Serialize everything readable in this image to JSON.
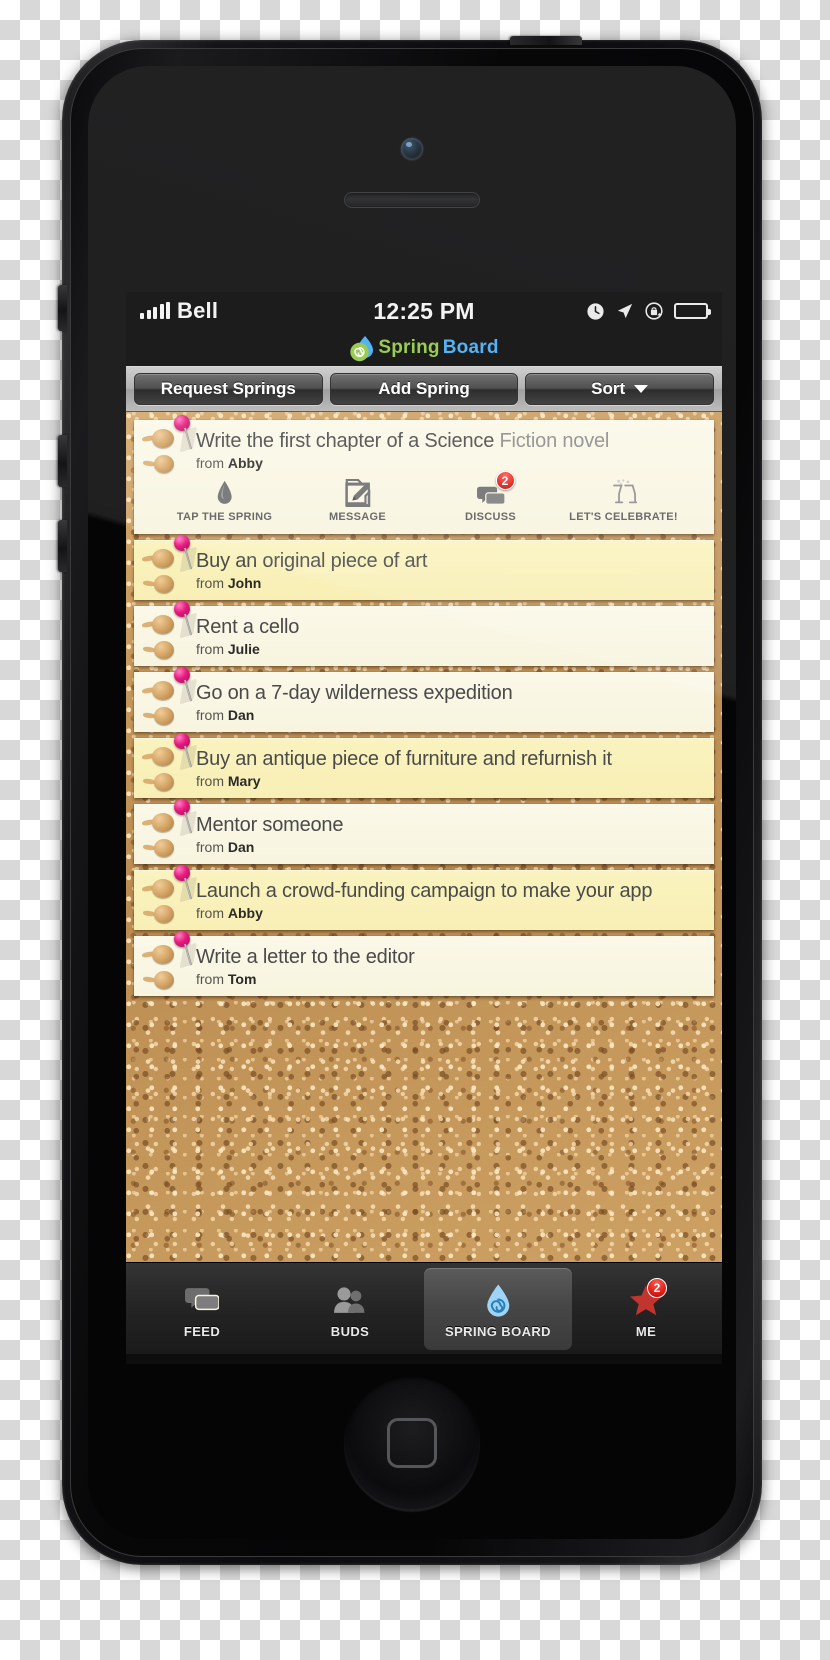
{
  "status_bar": {
    "carrier": "Bell",
    "time": "12:25 PM",
    "icons": [
      "clock-icon",
      "location-arrow-icon",
      "rotation-lock-icon",
      "battery-icon"
    ]
  },
  "app_header": {
    "logo_icon": "spring-droplet-logo-icon",
    "title_part_one": "Spring",
    "title_part_two": "Board",
    "color_spring": "#8cc63e",
    "color_board": "#3fa9f5"
  },
  "toolbar": {
    "request_springs_label": "Request Springs",
    "add_spring_label": "Add Spring",
    "sort_label": "Sort",
    "sort_caret_icon": "chevron-down-icon"
  },
  "notes": [
    {
      "title": "Write the first chapter of a Science",
      "title_dim": "Fiction novel",
      "from_prefix": "from",
      "from_name": "Abby",
      "shade": "cream",
      "expanded": true
    },
    {
      "title": "Buy an original piece of art",
      "title_dim": "",
      "from_prefix": "from",
      "from_name": "John",
      "shade": "yellow",
      "expanded": false
    },
    {
      "title": "Rent a cello",
      "title_dim": "",
      "from_prefix": "from",
      "from_name": "Julie",
      "shade": "cream",
      "expanded": false
    },
    {
      "title": "Go on a 7-day wilderness expedition",
      "title_dim": "",
      "from_prefix": "from",
      "from_name": "Dan",
      "shade": "cream",
      "expanded": false
    },
    {
      "title": "Buy an antique piece of furniture and refurnish it",
      "title_dim": "",
      "from_prefix": "from",
      "from_name": "Mary",
      "shade": "yellow",
      "expanded": false
    },
    {
      "title": "Mentor someone",
      "title_dim": "",
      "from_prefix": "from",
      "from_name": "Dan",
      "shade": "cream",
      "expanded": false
    },
    {
      "title": "Launch a crowd-funding campaign to make your app",
      "title_dim": "",
      "from_prefix": "from",
      "from_name": "Abby",
      "shade": "yellow",
      "expanded": false
    },
    {
      "title": "Write a letter to the editor",
      "title_dim": "",
      "from_prefix": "from",
      "from_name": "Tom",
      "shade": "cream",
      "expanded": false
    }
  ],
  "note_actions": [
    {
      "label": "TAP THE SPRING",
      "icon": "droplet-icon",
      "badge": ""
    },
    {
      "label": "MESSAGE",
      "icon": "compose-pencil-icon",
      "badge": ""
    },
    {
      "label": "DISCUSS",
      "icon": "speech-bubbles-icon",
      "badge": "2"
    },
    {
      "label": "LET'S CELEBRATE!",
      "icon": "champagne-glasses-icon",
      "badge": ""
    }
  ],
  "tab_bar": [
    {
      "label": "FEED",
      "icon": "speech-bubbles-icon",
      "selected": false,
      "badge": ""
    },
    {
      "label": "BUDS",
      "icon": "people-icon",
      "selected": false,
      "badge": ""
    },
    {
      "label": "SPRING BOARD",
      "icon": "spring-droplet-icon",
      "selected": true,
      "badge": ""
    },
    {
      "label": "ME",
      "icon": "star-icon",
      "selected": false,
      "badge": "2"
    }
  ]
}
